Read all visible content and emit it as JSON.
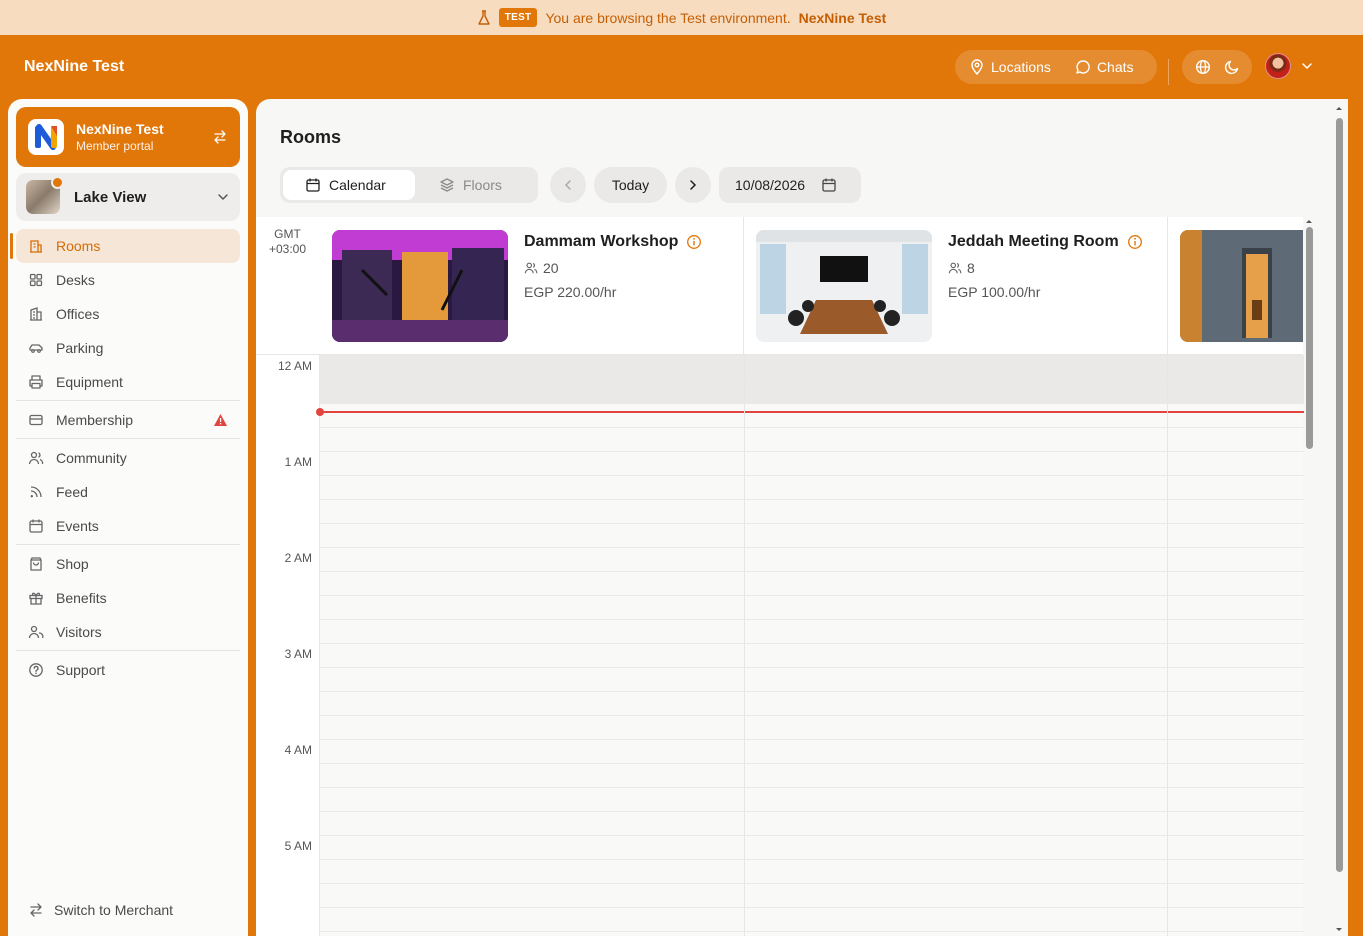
{
  "banner": {
    "badge": "TEST",
    "text": "You are browsing the Test environment.",
    "env_name": "NexNine Test"
  },
  "header": {
    "brand": "NexNine Test",
    "nav": [
      {
        "label": "Locations",
        "icon": "map-pin-icon"
      },
      {
        "label": "Chats",
        "icon": "chat-bubble-icon"
      }
    ]
  },
  "sidebar": {
    "portal": {
      "title": "NexNine Test",
      "subtitle": "Member portal"
    },
    "location": {
      "name": "Lake View"
    },
    "items": [
      {
        "label": "Rooms",
        "icon": "building-icon",
        "active": true
      },
      {
        "label": "Desks",
        "icon": "grid-icon"
      },
      {
        "label": "Offices",
        "icon": "office-building-icon"
      },
      {
        "label": "Parking",
        "icon": "car-icon"
      },
      {
        "label": "Equipment",
        "icon": "printer-icon"
      },
      {
        "label": "Membership",
        "icon": "card-icon",
        "warning": true
      },
      {
        "label": "Community",
        "icon": "people-icon"
      },
      {
        "label": "Feed",
        "icon": "rss-icon"
      },
      {
        "label": "Events",
        "icon": "calendar-icon"
      },
      {
        "label": "Shop",
        "icon": "shopping-bag-icon"
      },
      {
        "label": "Benefits",
        "icon": "gift-icon"
      },
      {
        "label": "Visitors",
        "icon": "visitors-icon"
      },
      {
        "label": "Support",
        "icon": "help-circle-icon"
      }
    ],
    "switch_label": "Switch to Merchant"
  },
  "main": {
    "title": "Rooms",
    "view_tabs": [
      {
        "label": "Calendar",
        "active": true
      },
      {
        "label": "Floors",
        "active": false
      }
    ],
    "today_label": "Today",
    "date": "10/08/2026",
    "timezone": "GMT\n+03:00",
    "rooms": [
      {
        "name": "Dammam Workshop",
        "capacity": "20",
        "price": "EGP 220.00/hr"
      },
      {
        "name": "Jeddah Meeting Room",
        "capacity": "8",
        "price": "EGP 100.00/hr"
      },
      {
        "name": "",
        "capacity": "",
        "price": ""
      }
    ],
    "hours": [
      "12 AM",
      "1 AM",
      "2 AM",
      "3 AM",
      "4 AM",
      "5 AM"
    ]
  },
  "colors": {
    "brand": "#e17609",
    "current_time": "#e2443f",
    "warning": "#e2443f"
  }
}
